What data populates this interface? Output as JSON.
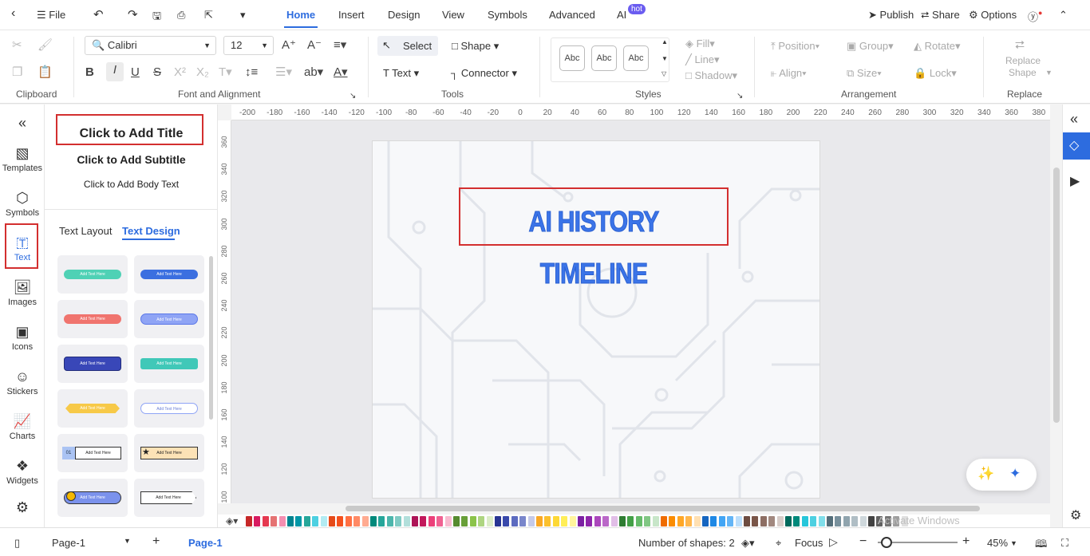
{
  "menubar": {
    "file": "File",
    "tabs": [
      "Home",
      "Insert",
      "Design",
      "View",
      "Symbols",
      "Advanced",
      "AI"
    ],
    "hot_badge": "hot",
    "publish": "Publish",
    "share": "Share",
    "options": "Options"
  },
  "ribbon": {
    "clipboard_label": "Clipboard",
    "font_label": "Font and Alignment",
    "tools_label": "Tools",
    "styles_label": "Styles",
    "arrangement_label": "Arrangement",
    "replace_label": "Replace",
    "font_name": "Calibri",
    "font_size": "12",
    "select": "Select",
    "shape": "Shape",
    "text": "Text",
    "connector": "Connector",
    "style_sample": "Abc",
    "fill": "Fill",
    "line": "Line",
    "shadow": "Shadow",
    "position": "Position",
    "group": "Group",
    "rotate": "Rotate",
    "align": "Align",
    "size": "Size",
    "lock": "Lock",
    "replace_shape_1": "Replace",
    "replace_shape_2": "Shape"
  },
  "leftrail": [
    "Templates",
    "Symbols",
    "Text",
    "Images",
    "Icons",
    "Stickers",
    "Charts",
    "Widgets"
  ],
  "panel": {
    "add_title": "Click to Add Title",
    "add_subtitle": "Click to Add Subtitle",
    "add_body": "Click to Add Body Text",
    "tab_layout": "Text Layout",
    "tab_design": "Text Design",
    "card_text": "Add Text Here",
    "card_num": "01"
  },
  "ruler_top": [
    "-200",
    "-180",
    "-160",
    "-140",
    "-120",
    "-100",
    "-80",
    "-60",
    "-40",
    "-20",
    "0",
    "20",
    "40",
    "60",
    "80",
    "100",
    "120",
    "140",
    "160",
    "180",
    "200",
    "220",
    "240",
    "260",
    "280",
    "300",
    "320",
    "340",
    "360",
    "380"
  ],
  "ruler_left": [
    "360",
    "340",
    "320",
    "300",
    "280",
    "260",
    "240",
    "220",
    "200",
    "180",
    "160",
    "140",
    "120",
    "100"
  ],
  "document": {
    "title": "AI HISTORY TIMELINE"
  },
  "statusbar": {
    "page_select": "Page-1",
    "page_tab": "Page-1",
    "shapes": "Number of shapes: 2",
    "focus": "Focus",
    "zoom": "45%"
  },
  "watermark": "Activate Windows",
  "colors": {
    "accent": "#2d6cdf",
    "highlight": "#d32f2f",
    "palette": [
      "#c62828",
      "#d81b60",
      "#e53950",
      "#e57373",
      "#f48fb1",
      "#00838f",
      "#0097a7",
      "#26a69a",
      "#4dd0e1",
      "#b2ebf2",
      "#e64a19",
      "#f4511e",
      "#ff7043",
      "#ff8a65",
      "#ffab91",
      "#00897b",
      "#26a69a",
      "#4db6ac",
      "#80cbc4",
      "#b2dfdb",
      "#ad1457",
      "#c2185b",
      "#ec407a",
      "#f06292",
      "#f8bbd0",
      "#558b2f",
      "#689f38",
      "#8bc34a",
      "#aed581",
      "#dcedc8",
      "#283593",
      "#3949ab",
      "#5c6bc0",
      "#7986cb",
      "#c5cae9",
      "#f9a825",
      "#fbc02d",
      "#fdd835",
      "#ffee58",
      "#fff59d",
      "#7b1fa2",
      "#8e24aa",
      "#ab47bc",
      "#ba68c8",
      "#e1bee7",
      "#2e7d32",
      "#43a047",
      "#66bb6a",
      "#81c784",
      "#c8e6c9",
      "#ef6c00",
      "#fb8c00",
      "#ffa726",
      "#ffb74d",
      "#ffe0b2",
      "#1565c0",
      "#1e88e5",
      "#42a5f5",
      "#64b5f6",
      "#bbdefb",
      "#6d4c41",
      "#795548",
      "#8d6e63",
      "#a1887f",
      "#d7ccc8",
      "#00695c",
      "#00897b",
      "#26c6da",
      "#4dd0e1",
      "#80deea",
      "#546e7a",
      "#78909c",
      "#90a4ae",
      "#b0bec5",
      "#cfd8dc",
      "#424242",
      "#616161",
      "#757575",
      "#9e9e9e",
      "#e0e0e0"
    ]
  }
}
